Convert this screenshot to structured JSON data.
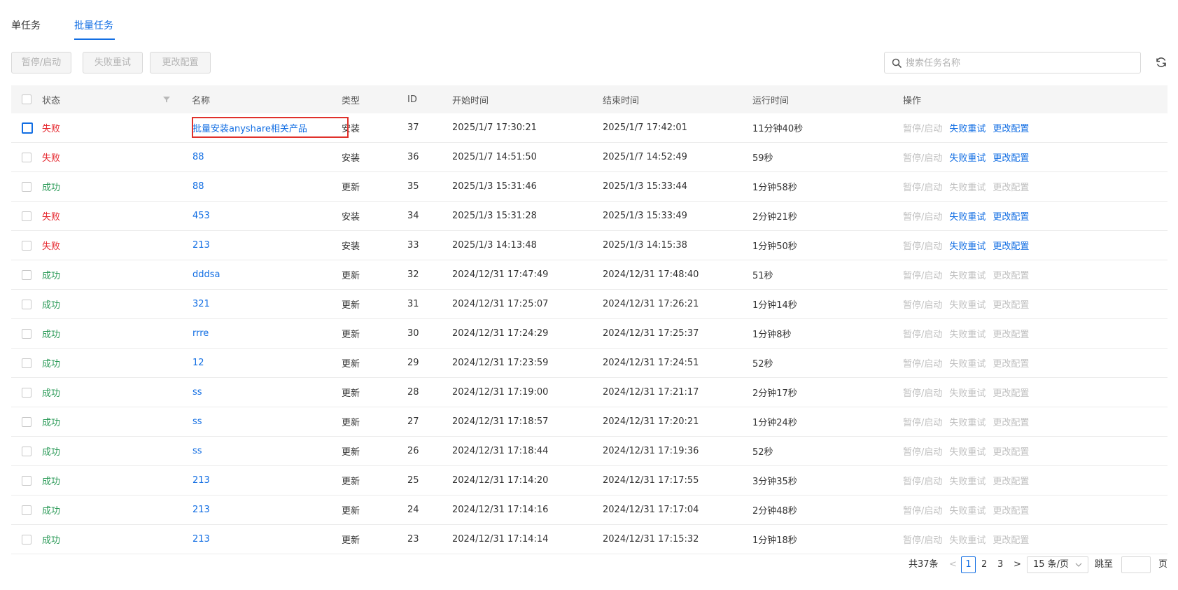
{
  "tabs": [
    {
      "label": "单任务",
      "active": false
    },
    {
      "label": "批量任务",
      "active": true
    }
  ],
  "toolbar": {
    "pause_start": "暂停/启动",
    "retry_failed": "失败重试",
    "change_config": "更改配置",
    "search_placeholder": "搜索任务名称"
  },
  "table": {
    "columns": {
      "status": "状态",
      "name": "名称",
      "type": "类型",
      "id": "ID",
      "start": "开始时间",
      "end": "结束时间",
      "runtime": "运行时间",
      "actions": "操作"
    },
    "action_labels": [
      "暂停/启动",
      "失败重试",
      "更改配置"
    ],
    "rows": [
      {
        "status": "失败",
        "name": "批量安装anyshare相关产品",
        "type": "安装",
        "id": "37",
        "start": "2025/1/7 17:30:21",
        "end": "2025/1/7 17:42:01",
        "runtime": "11分钟40秒"
      },
      {
        "status": "失败",
        "name": "88",
        "type": "安装",
        "id": "36",
        "start": "2025/1/7 14:51:50",
        "end": "2025/1/7 14:52:49",
        "runtime": "59秒"
      },
      {
        "status": "成功",
        "name": "88",
        "type": "更新",
        "id": "35",
        "start": "2025/1/3 15:31:46",
        "end": "2025/1/3 15:33:44",
        "runtime": "1分钟58秒"
      },
      {
        "status": "失败",
        "name": "453",
        "type": "安装",
        "id": "34",
        "start": "2025/1/3 15:31:28",
        "end": "2025/1/3 15:33:49",
        "runtime": "2分钟21秒"
      },
      {
        "status": "失败",
        "name": "213",
        "type": "安装",
        "id": "33",
        "start": "2025/1/3 14:13:48",
        "end": "2025/1/3 14:15:38",
        "runtime": "1分钟50秒"
      },
      {
        "status": "成功",
        "name": "dddsa",
        "type": "更新",
        "id": "32",
        "start": "2024/12/31 17:47:49",
        "end": "2024/12/31 17:48:40",
        "runtime": "51秒"
      },
      {
        "status": "成功",
        "name": "321",
        "type": "更新",
        "id": "31",
        "start": "2024/12/31 17:25:07",
        "end": "2024/12/31 17:26:21",
        "runtime": "1分钟14秒"
      },
      {
        "status": "成功",
        "name": "rrre",
        "type": "更新",
        "id": "30",
        "start": "2024/12/31 17:24:29",
        "end": "2024/12/31 17:25:37",
        "runtime": "1分钟8秒"
      },
      {
        "status": "成功",
        "name": "12",
        "type": "更新",
        "id": "29",
        "start": "2024/12/31 17:23:59",
        "end": "2024/12/31 17:24:51",
        "runtime": "52秒"
      },
      {
        "status": "成功",
        "name": "ss",
        "type": "更新",
        "id": "28",
        "start": "2024/12/31 17:19:00",
        "end": "2024/12/31 17:21:17",
        "runtime": "2分钟17秒"
      },
      {
        "status": "成功",
        "name": "ss",
        "type": "更新",
        "id": "27",
        "start": "2024/12/31 17:18:57",
        "end": "2024/12/31 17:20:21",
        "runtime": "1分钟24秒"
      },
      {
        "status": "成功",
        "name": "ss",
        "type": "更新",
        "id": "26",
        "start": "2024/12/31 17:18:44",
        "end": "2024/12/31 17:19:36",
        "runtime": "52秒"
      },
      {
        "status": "成功",
        "name": "213",
        "type": "更新",
        "id": "25",
        "start": "2024/12/31 17:14:20",
        "end": "2024/12/31 17:17:55",
        "runtime": "3分钟35秒"
      },
      {
        "status": "成功",
        "name": "213",
        "type": "更新",
        "id": "24",
        "start": "2024/12/31 17:14:16",
        "end": "2024/12/31 17:17:04",
        "runtime": "2分钟48秒"
      },
      {
        "status": "成功",
        "name": "213",
        "type": "更新",
        "id": "23",
        "start": "2024/12/31 17:14:14",
        "end": "2024/12/31 17:15:32",
        "runtime": "1分钟18秒"
      }
    ]
  },
  "pagination": {
    "total": "共37条",
    "prev": "<",
    "pages": [
      "1",
      "2",
      "3"
    ],
    "current_page": "1",
    "next": ">",
    "page_size": "15 条/页",
    "jump_label": "跳至",
    "page_suffix": "页"
  },
  "colors": {
    "accent": "#126ee3",
    "fail": "#e5242b",
    "success": "#2a9a57",
    "highlight_box": "#e0312b"
  },
  "icons": {
    "search": "search-icon",
    "refresh": "refresh-icon",
    "filter": "filter-icon",
    "dropdown": "chevron-down-icon"
  }
}
